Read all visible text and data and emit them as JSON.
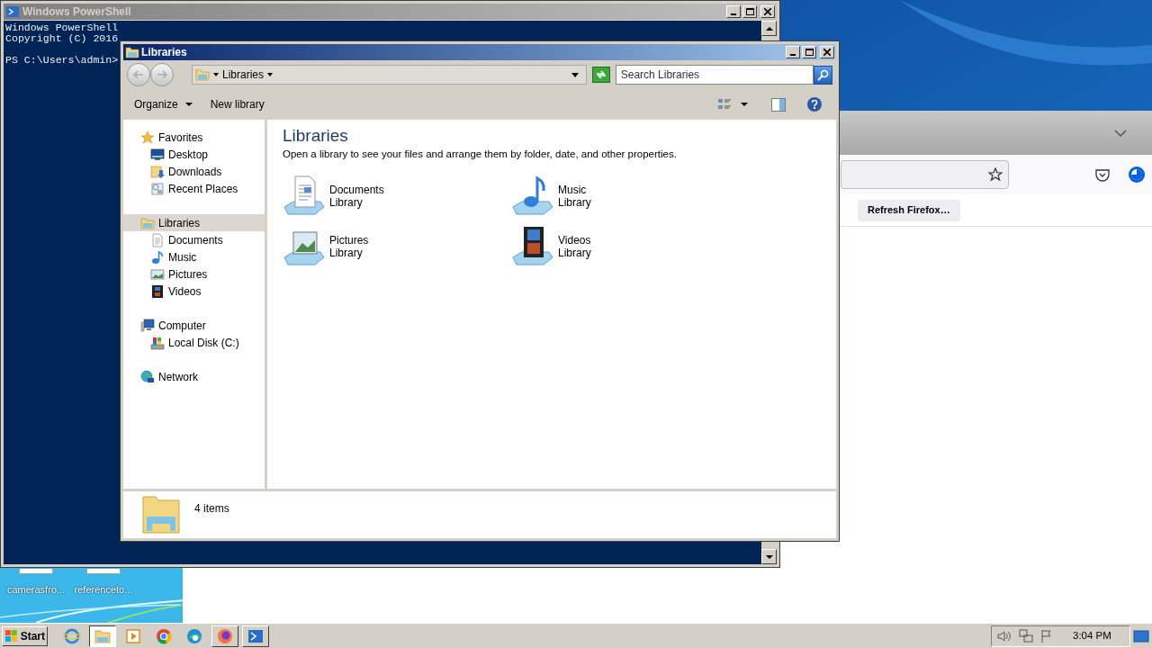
{
  "desktop": {
    "icons": [
      {
        "label": "camerasfro..."
      },
      {
        "label": "referenceto..."
      }
    ]
  },
  "firefox": {
    "refresh_button": "Refresh Firefox…"
  },
  "powershell": {
    "title": "Windows PowerShell",
    "lines": [
      "Windows PowerShell",
      "Copyright (C) 2016"
    ],
    "prompt": "PS C:\\Users\\admin>"
  },
  "explorer": {
    "title": "Libraries",
    "breadcrumb": "Libraries",
    "search_placeholder": "Search Libraries",
    "toolbar": [
      {
        "label": "Organize",
        "dropdown": true
      },
      {
        "label": "New library",
        "dropdown": false
      }
    ],
    "nav": [
      {
        "label": "Favorites",
        "kind": "star",
        "selected": false,
        "children": [
          {
            "label": "Desktop",
            "kind": "desktop",
            "selected": false
          },
          {
            "label": "Downloads",
            "kind": "downloads",
            "selected": false
          },
          {
            "label": "Recent Places",
            "kind": "recent",
            "selected": false
          }
        ]
      },
      {
        "label": "Libraries",
        "kind": "libraries",
        "selected": true,
        "children": [
          {
            "label": "Documents",
            "kind": "document",
            "selected": false
          },
          {
            "label": "Music",
            "kind": "music",
            "selected": false
          },
          {
            "label": "Pictures",
            "kind": "pictures",
            "selected": false
          },
          {
            "label": "Videos",
            "kind": "videos",
            "selected": false
          }
        ]
      },
      {
        "label": "Computer",
        "kind": "computer",
        "selected": false,
        "children": [
          {
            "label": "Local Disk (C:)",
            "kind": "disk",
            "selected": false
          }
        ]
      },
      {
        "label": "Network",
        "kind": "network",
        "selected": false
      }
    ],
    "heading": "Libraries",
    "description": "Open a library to see your files and arrange them by folder, date, and other properties.",
    "libraries": [
      {
        "name": "Documents",
        "type": "Library",
        "kind": "document"
      },
      {
        "name": "Music",
        "type": "Library",
        "kind": "music"
      },
      {
        "name": "Pictures",
        "type": "Library",
        "kind": "pictures"
      },
      {
        "name": "Videos",
        "type": "Library",
        "kind": "videos"
      }
    ],
    "status": "4 items"
  },
  "taskbar": {
    "start": "Start",
    "apps": [
      {
        "kind": "ie",
        "open": false,
        "selected": false
      },
      {
        "kind": "explorer",
        "open": true,
        "selected": true
      },
      {
        "kind": "media",
        "open": false,
        "selected": false
      },
      {
        "kind": "chrome",
        "open": false,
        "selected": false
      },
      {
        "kind": "edge",
        "open": false,
        "selected": false
      },
      {
        "kind": "firefox",
        "open": true,
        "selected": false
      },
      {
        "kind": "powershell",
        "open": true,
        "selected": false
      }
    ],
    "clock": "3:04 PM"
  }
}
